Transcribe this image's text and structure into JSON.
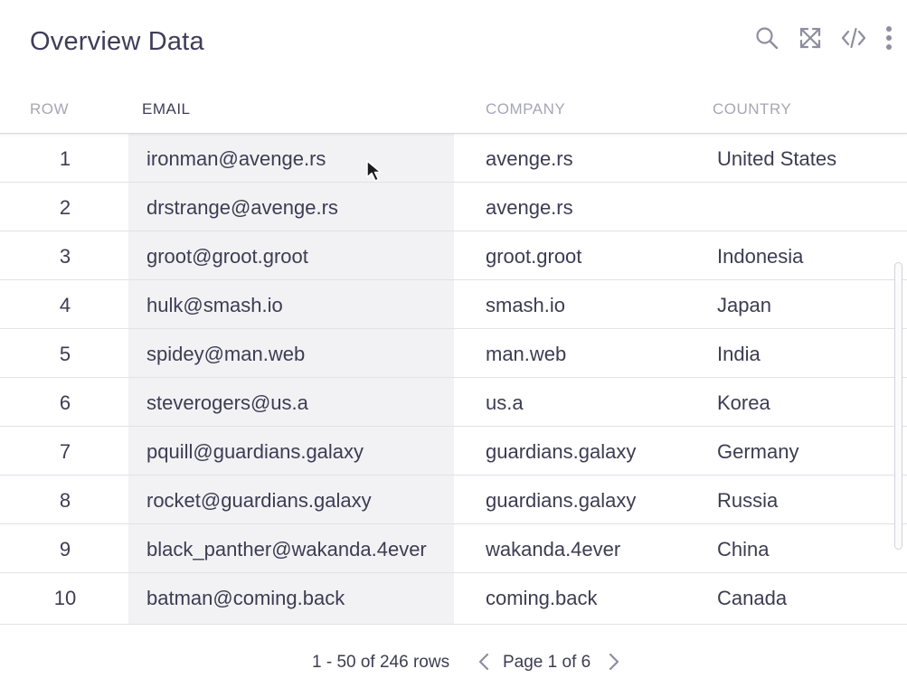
{
  "header": {
    "title": "Overview Data",
    "tools": [
      {
        "icon": "search-icon"
      },
      {
        "icon": "expand-icon"
      },
      {
        "icon": "code-icon"
      },
      {
        "icon": "more-vertical-icon"
      }
    ]
  },
  "table": {
    "columns": {
      "row": "ROW",
      "email": "EMAIL",
      "company": "COMPANY",
      "country": "COUNTRY"
    },
    "active_column": "email",
    "rows": [
      {
        "num": "1",
        "email": "ironman@avenge.rs",
        "company": "avenge.rs",
        "country": "United States"
      },
      {
        "num": "2",
        "email": "drstrange@avenge.rs",
        "company": "avenge.rs",
        "country": ""
      },
      {
        "num": "3",
        "email": "groot@groot.groot",
        "company": "groot.groot",
        "country": "Indonesia"
      },
      {
        "num": "4",
        "email": "hulk@smash.io",
        "company": "smash.io",
        "country": "Japan"
      },
      {
        "num": "5",
        "email": "spidey@man.web",
        "company": "man.web",
        "country": "India"
      },
      {
        "num": "6",
        "email": "steverogers@us.a",
        "company": "us.a",
        "country": "Korea"
      },
      {
        "num": "7",
        "email": "pquill@guardians.galaxy",
        "company": "guardians.galaxy",
        "country": "Germany"
      },
      {
        "num": "8",
        "email": "rocket@guardians.galaxy",
        "company": "guardians.galaxy",
        "country": "Russia"
      },
      {
        "num": "9",
        "email": "black_panther@wakanda.4ever",
        "company": "wakanda.4ever",
        "country": "China"
      },
      {
        "num": "10",
        "email": "batman@coming.back",
        "company": "coming.back",
        "country": "Canada"
      }
    ]
  },
  "footer": {
    "rows_info": "1 - 50 of 246 rows",
    "page_info": "Page 1 of 6"
  },
  "colors": {
    "text": "#3d3c52",
    "muted": "#a7a6b6",
    "band": "#f2f2f5",
    "border": "#e1e1e7"
  }
}
